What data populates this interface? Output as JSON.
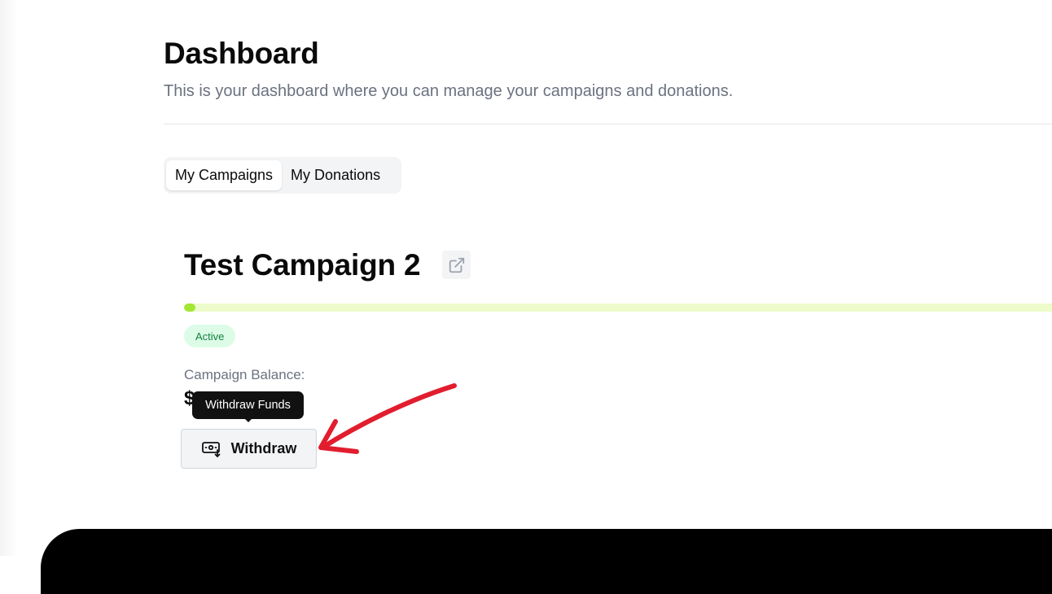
{
  "page": {
    "title": "Dashboard",
    "subtitle": "This is your dashboard where you can manage your campaigns and donations."
  },
  "tabs": [
    {
      "label": "My Campaigns",
      "active": true
    },
    {
      "label": "My Donations",
      "active": false
    }
  ],
  "campaign": {
    "title": "Test Campaign 2",
    "external_link_icon": "external-link-icon",
    "progress_fraction": 0.013,
    "status": "Active",
    "balance_label": "Campaign Balance:",
    "balance_value_visible": "$",
    "withdraw_tooltip": "Withdraw Funds",
    "withdraw_label": "Withdraw",
    "withdraw_icon": "money-withdraw-icon"
  },
  "colors": {
    "progress_fill": "#a3e635",
    "progress_track": "#ecfccb",
    "status_bg": "#dcfce7",
    "status_text": "#15803d",
    "annotation_arrow": "#e11d2e"
  }
}
